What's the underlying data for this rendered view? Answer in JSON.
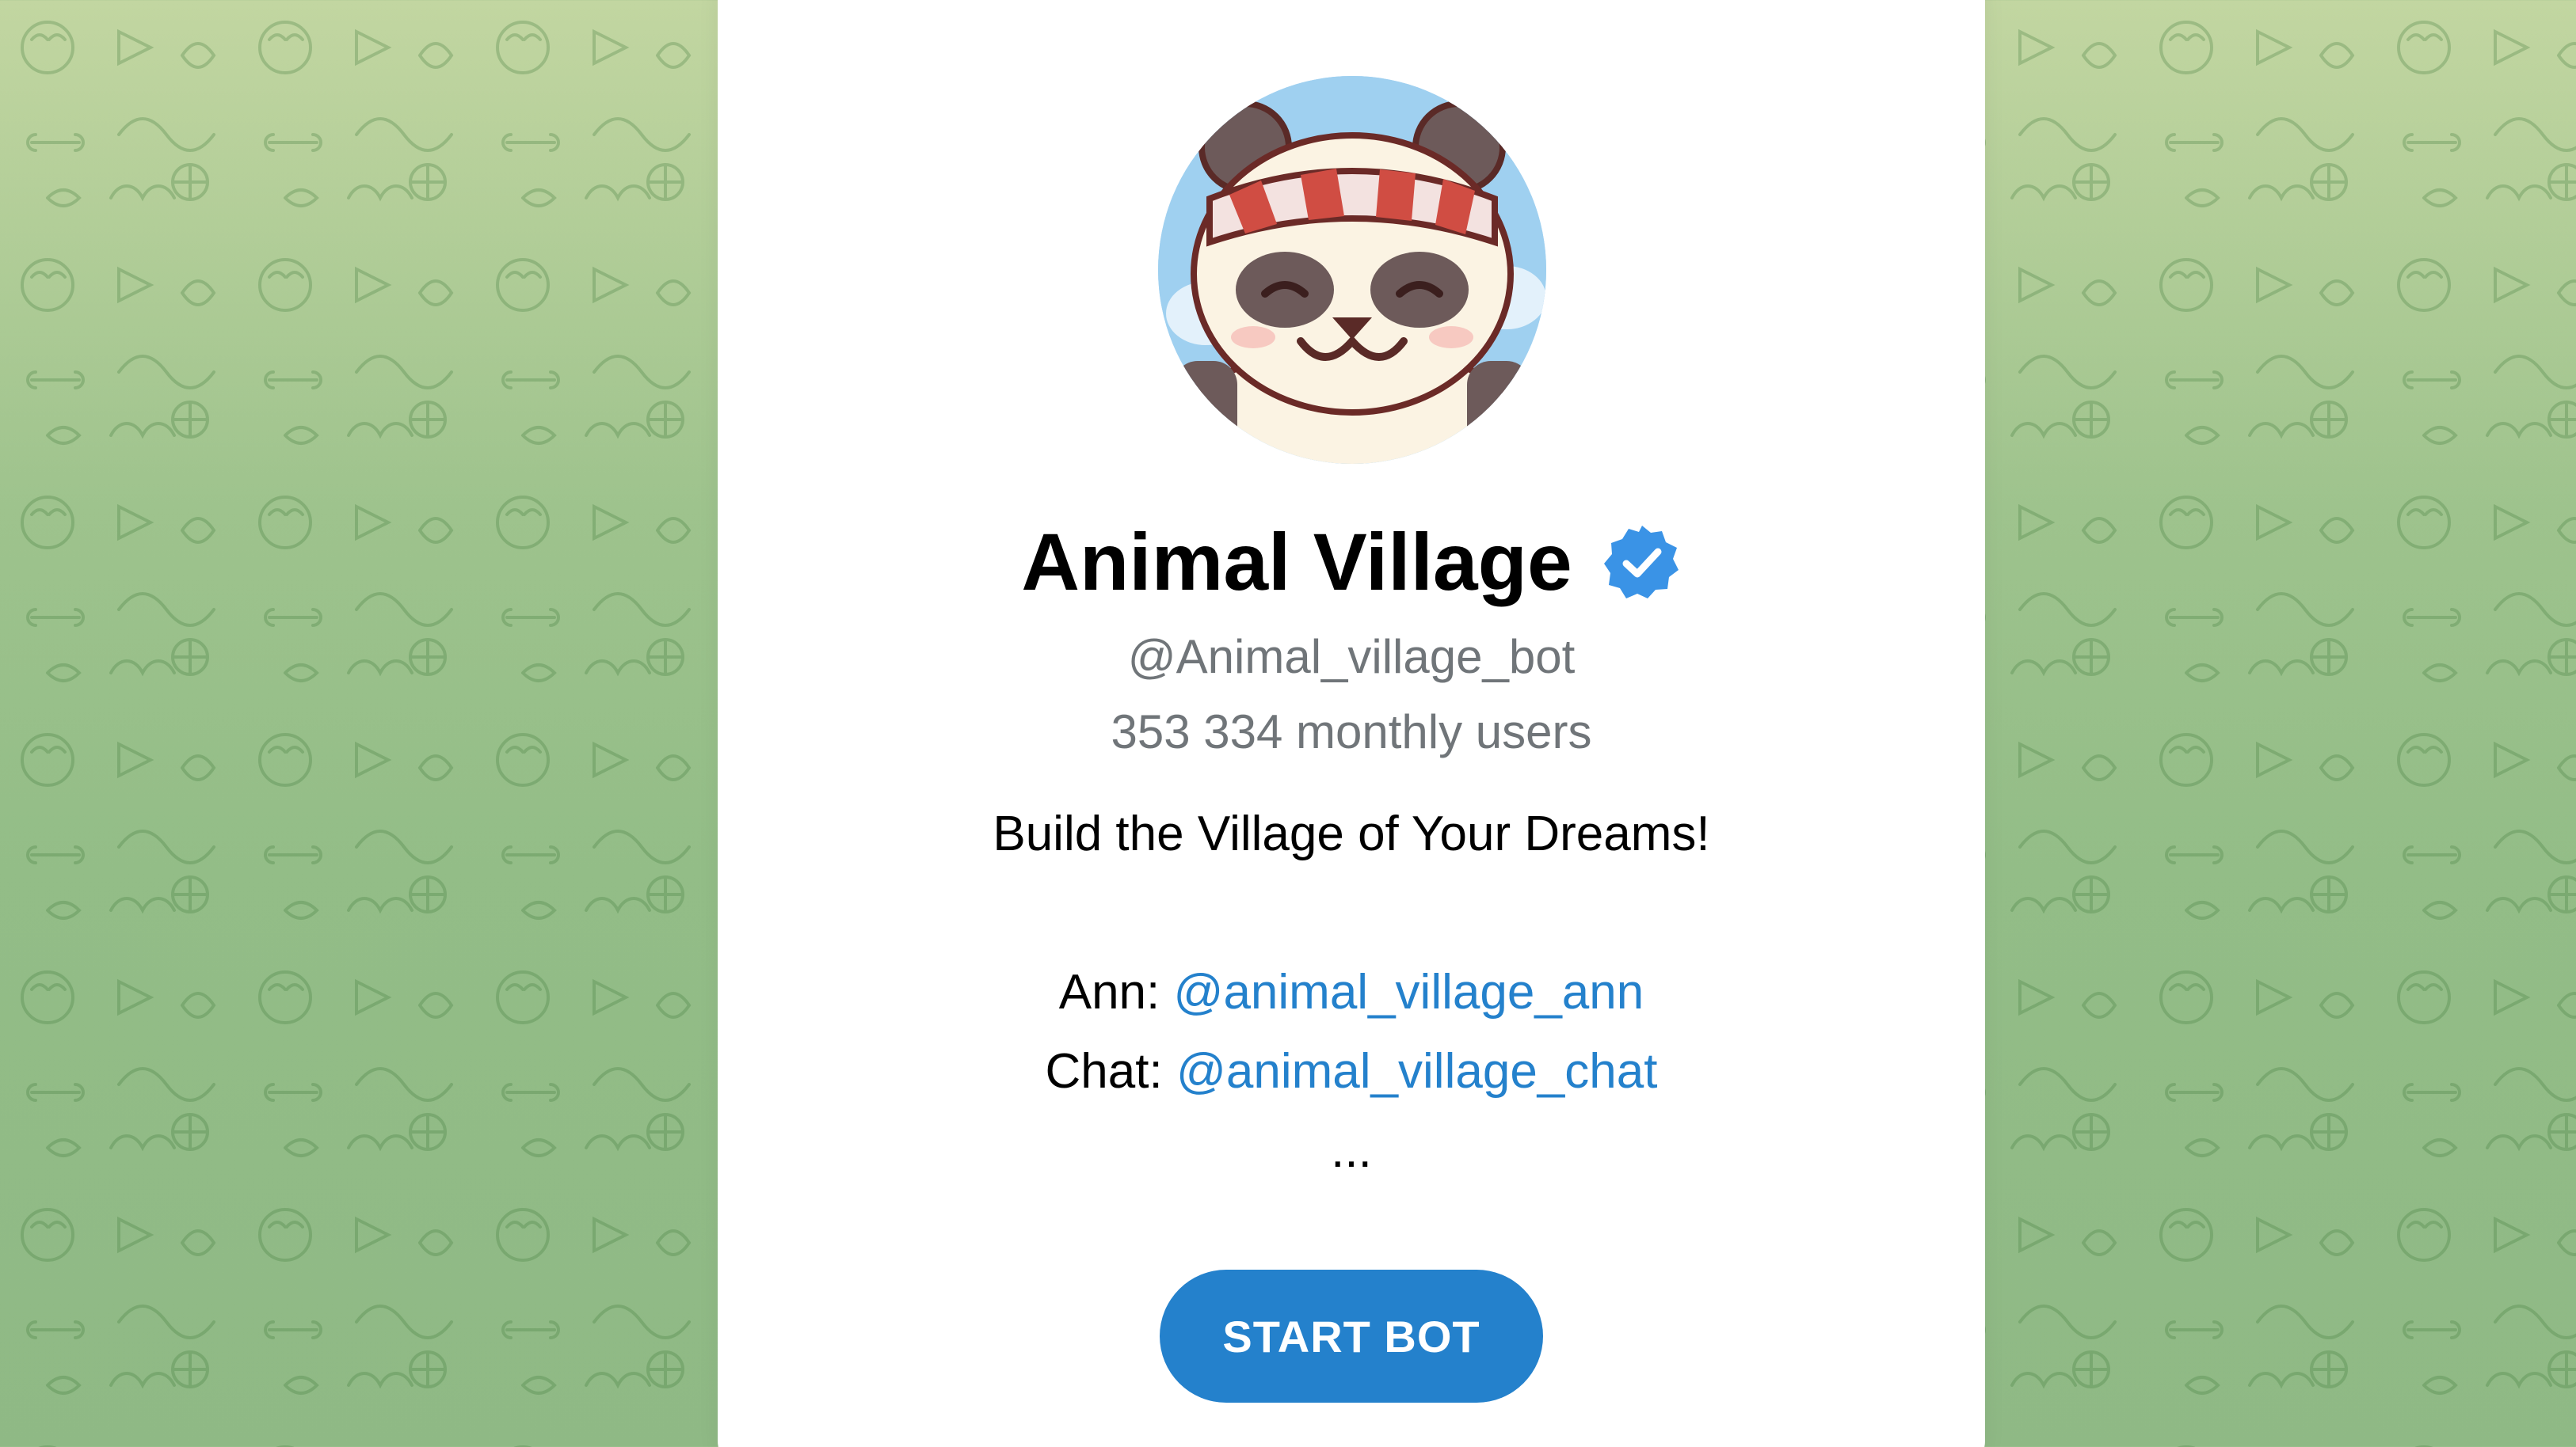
{
  "bot": {
    "name": "Animal Village",
    "username": "@Animal_village_bot",
    "monthly_users": "353 334 monthly users",
    "description": "Build the Village of Your Dreams!",
    "links": [
      {
        "label": "Ann:",
        "handle": "@animal_village_ann"
      },
      {
        "label": "Chat:",
        "handle": "@animal_village_chat"
      }
    ],
    "ellipsis": "...",
    "verified_icon": "verified-badge-icon",
    "avatar_icon": "panda-avatar"
  },
  "actions": {
    "start_label": "START BOT"
  },
  "colors": {
    "accent": "#2481cc",
    "muted_text": "#707579",
    "background_green": "#9ec38d"
  }
}
